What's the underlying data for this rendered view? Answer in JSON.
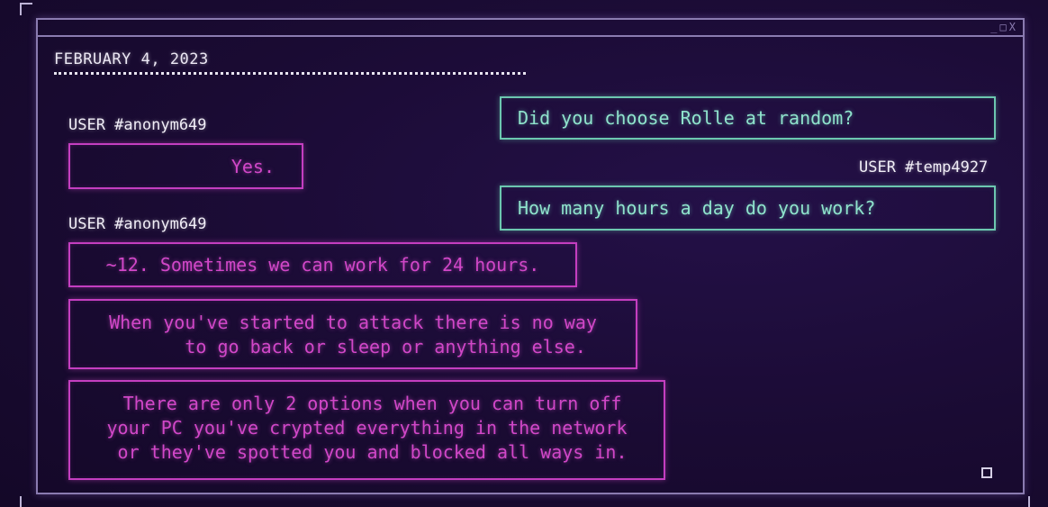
{
  "window": {
    "controls": [
      "_",
      "□",
      "X"
    ]
  },
  "conversation": {
    "date": "FEBRUARY 4, 2023",
    "left_user_1": "USER #anonym649",
    "left_msg_1": "Yes.",
    "left_user_2": "USER #anonym649",
    "left_msg_2": "~12. Sometimes we can work for 24 hours.",
    "left_msg_3": "When you've started to attack there is no way\n      to go back or sleep or anything else.",
    "left_msg_4": " There are only 2 options when you can turn off\nyour PC you've crypted everything in the network\n or they've spotted you and blocked all ways in.",
    "right_msg_1": "Did you choose Rolle at random?",
    "right_user_1": "USER #temp4927",
    "right_msg_2": "How many hours a day do you work?"
  },
  "colors": {
    "background": "#1a0b33",
    "window_border": "#8a7bb0",
    "pink_accent": "#d147c8",
    "teal_accent": "#8fe3cc"
  }
}
